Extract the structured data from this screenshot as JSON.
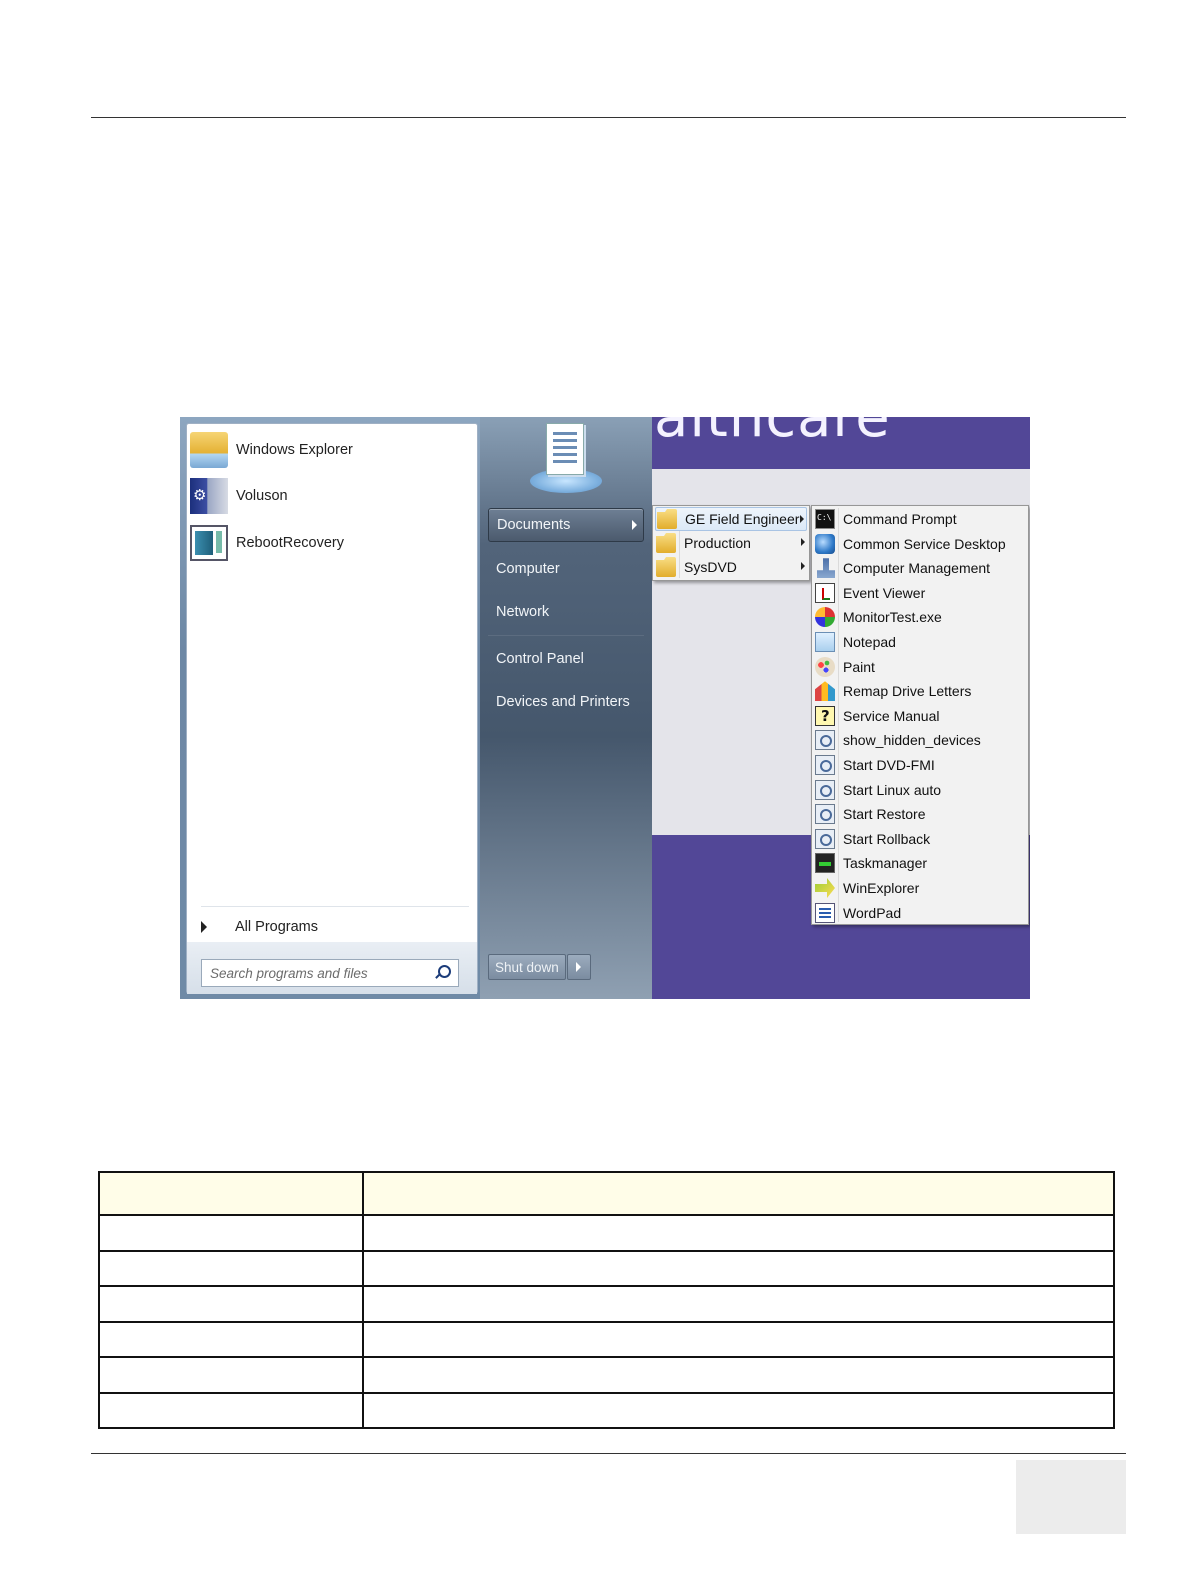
{
  "desktop": {
    "brand_text": "althcare"
  },
  "start_menu": {
    "pinned": [
      {
        "label": "Windows Explorer",
        "icon": "folder-explorer-icon"
      },
      {
        "label": "Voluson",
        "icon": "voluson-icon"
      },
      {
        "label": "RebootRecovery",
        "icon": "reboot-recovery-icon"
      }
    ],
    "all_programs_label": "All Programs",
    "search_placeholder": "Search programs and files",
    "right_items": [
      {
        "label": "Documents",
        "selected": true
      },
      {
        "label": "Computer"
      },
      {
        "label": "Network"
      },
      {
        "label": "Control Panel"
      },
      {
        "label": "Devices and Printers"
      }
    ],
    "shutdown_label": "Shut down"
  },
  "documents_submenu": [
    {
      "label": "GE Field Engineer",
      "icon": "folder-icon",
      "has_submenu": true,
      "highlighted": true
    },
    {
      "label": "Production",
      "icon": "folder-icon",
      "has_submenu": true
    },
    {
      "label": "SysDVD",
      "icon": "folder-icon",
      "has_submenu": true
    }
  ],
  "field_engineer_submenu": [
    {
      "label": "Command Prompt",
      "icon": "cmd-icon"
    },
    {
      "label": "Common Service Desktop",
      "icon": "globe-icon"
    },
    {
      "label": "Computer Management",
      "icon": "computer-management-icon"
    },
    {
      "label": "Event Viewer",
      "icon": "event-viewer-icon"
    },
    {
      "label": "MonitorTest.exe",
      "icon": "monitor-test-icon"
    },
    {
      "label": "Notepad",
      "icon": "notepad-icon"
    },
    {
      "label": "Paint",
      "icon": "paint-icon"
    },
    {
      "label": "Remap Drive Letters",
      "icon": "remap-icon"
    },
    {
      "label": "Service Manual",
      "icon": "help-icon"
    },
    {
      "label": "show_hidden_devices",
      "icon": "script-icon"
    },
    {
      "label": "Start DVD-FMI",
      "icon": "script-icon"
    },
    {
      "label": "Start Linux auto",
      "icon": "script-icon"
    },
    {
      "label": "Start Restore",
      "icon": "script-icon"
    },
    {
      "label": "Start Rollback",
      "icon": "script-icon"
    },
    {
      "label": "Taskmanager",
      "icon": "taskmanager-icon"
    },
    {
      "label": "WinExplorer",
      "icon": "winexplorer-icon"
    },
    {
      "label": "WordPad",
      "icon": "wordpad-icon"
    }
  ],
  "colors": {
    "desktop_purple": "#524797",
    "table_header": "#fffde8"
  }
}
